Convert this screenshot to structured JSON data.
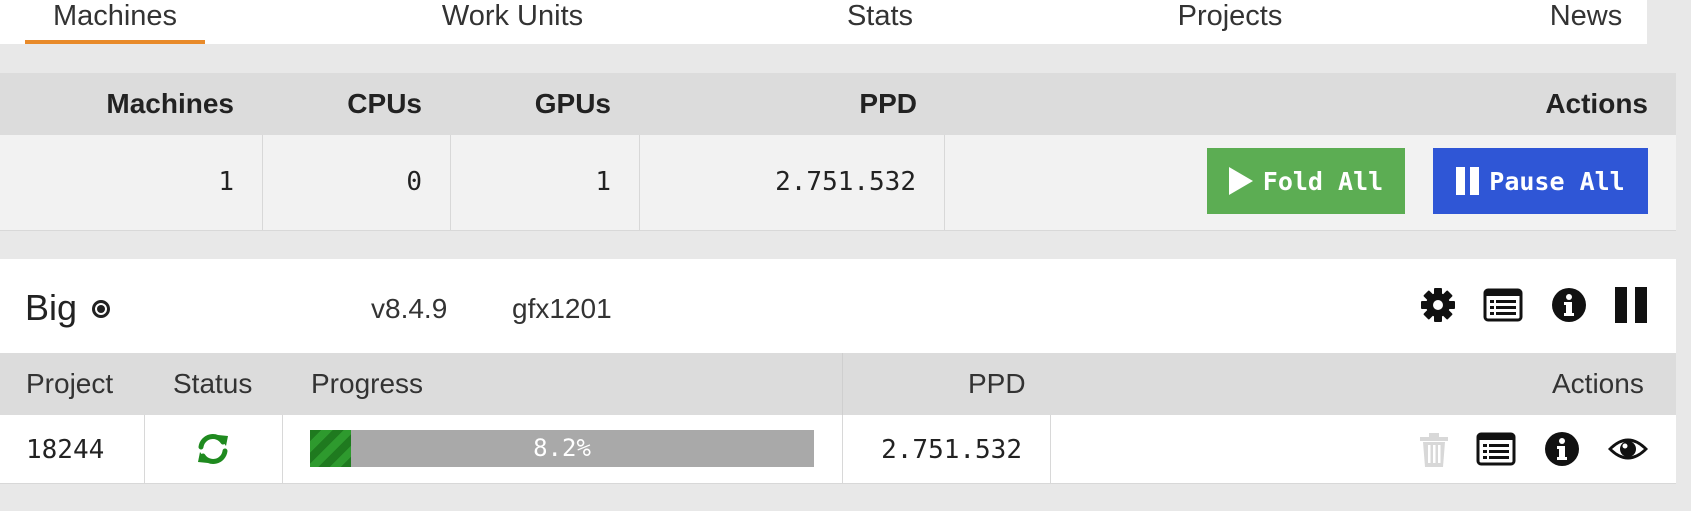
{
  "nav": {
    "items": [
      {
        "label": "Machines",
        "active": true
      },
      {
        "label": "Work Units",
        "active": false
      },
      {
        "label": "Stats",
        "active": false
      },
      {
        "label": "Projects",
        "active": false
      },
      {
        "label": "News",
        "active": false
      }
    ]
  },
  "summary": {
    "headers": {
      "machines": "Machines",
      "cpus": "CPUs",
      "gpus": "GPUs",
      "ppd": "PPD",
      "actions": "Actions"
    },
    "values": {
      "machines": "1",
      "cpus": "0",
      "gpus": "1",
      "ppd": "2.751.532"
    },
    "fold_all_label": "Fold All",
    "pause_all_label": "Pause All",
    "fold_all_icon": "play-icon",
    "pause_all_icon": "pause-icon"
  },
  "machine": {
    "name": "Big",
    "status_icon": "radio-dot-icon",
    "version": "v8.4.9",
    "gpu": "gfx1201",
    "actions_icons": [
      "gear-icon",
      "log-list-icon",
      "info-icon",
      "pause-icon"
    ]
  },
  "work_units": {
    "headers": {
      "project": "Project",
      "status": "Status",
      "progress": "Progress",
      "ppd": "PPD",
      "actions": "Actions"
    },
    "rows": [
      {
        "project": "18244",
        "status_icon": "sync-icon",
        "progress_percent": 8.2,
        "progress_label": "8.2%",
        "ppd": "2.751.532",
        "actions_icons": [
          "trash-icon",
          "log-list-icon",
          "info-icon",
          "eye-icon"
        ]
      }
    ]
  },
  "colors": {
    "accent_underline": "#e88a2a",
    "fold_button": "#5cad53",
    "pause_button": "#2f56d6",
    "status_green": "#1f8a1f",
    "progress_track": "#a9a9a9"
  }
}
